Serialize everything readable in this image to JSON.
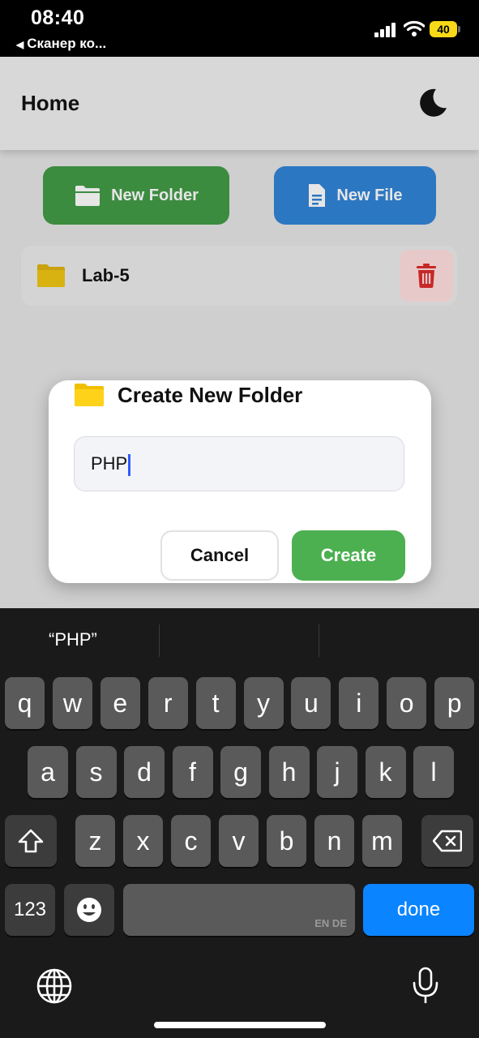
{
  "status_bar": {
    "time": "08:40",
    "back_app": "Сканер ко...",
    "battery": "40"
  },
  "header": {
    "title": "Home",
    "theme_icon": "moon-icon"
  },
  "actions": {
    "new_folder_label": "New Folder",
    "new_folder_icon": "folder-open-icon",
    "new_file_label": "New File",
    "new_file_icon": "file-icon"
  },
  "items": [
    {
      "name": "Lab-5",
      "icon": "folder-icon",
      "delete_icon": "trash-icon"
    }
  ],
  "dialog": {
    "title": "Create New Folder",
    "input_value": "PHP",
    "cancel_label": "Cancel",
    "create_label": "Create"
  },
  "keyboard": {
    "suggestion": "“PHP”",
    "row1": [
      "q",
      "w",
      "e",
      "r",
      "t",
      "y",
      "u",
      "i",
      "o",
      "p"
    ],
    "row2": [
      "a",
      "s",
      "d",
      "f",
      "g",
      "h",
      "j",
      "k",
      "l"
    ],
    "row3": [
      "z",
      "x",
      "c",
      "v",
      "b",
      "n",
      "m"
    ],
    "numbers_label": "123",
    "space_lang": "EN DE",
    "done_label": "done"
  },
  "colors": {
    "new_folder_bg": "#3c8c40",
    "new_file_bg": "#2c77c2",
    "create_bg": "#4cb050",
    "done_bg": "#0a84ff",
    "battery": "#f7d917",
    "folder_yellow": "#f5c518",
    "delete_red": "#d32f2f"
  }
}
